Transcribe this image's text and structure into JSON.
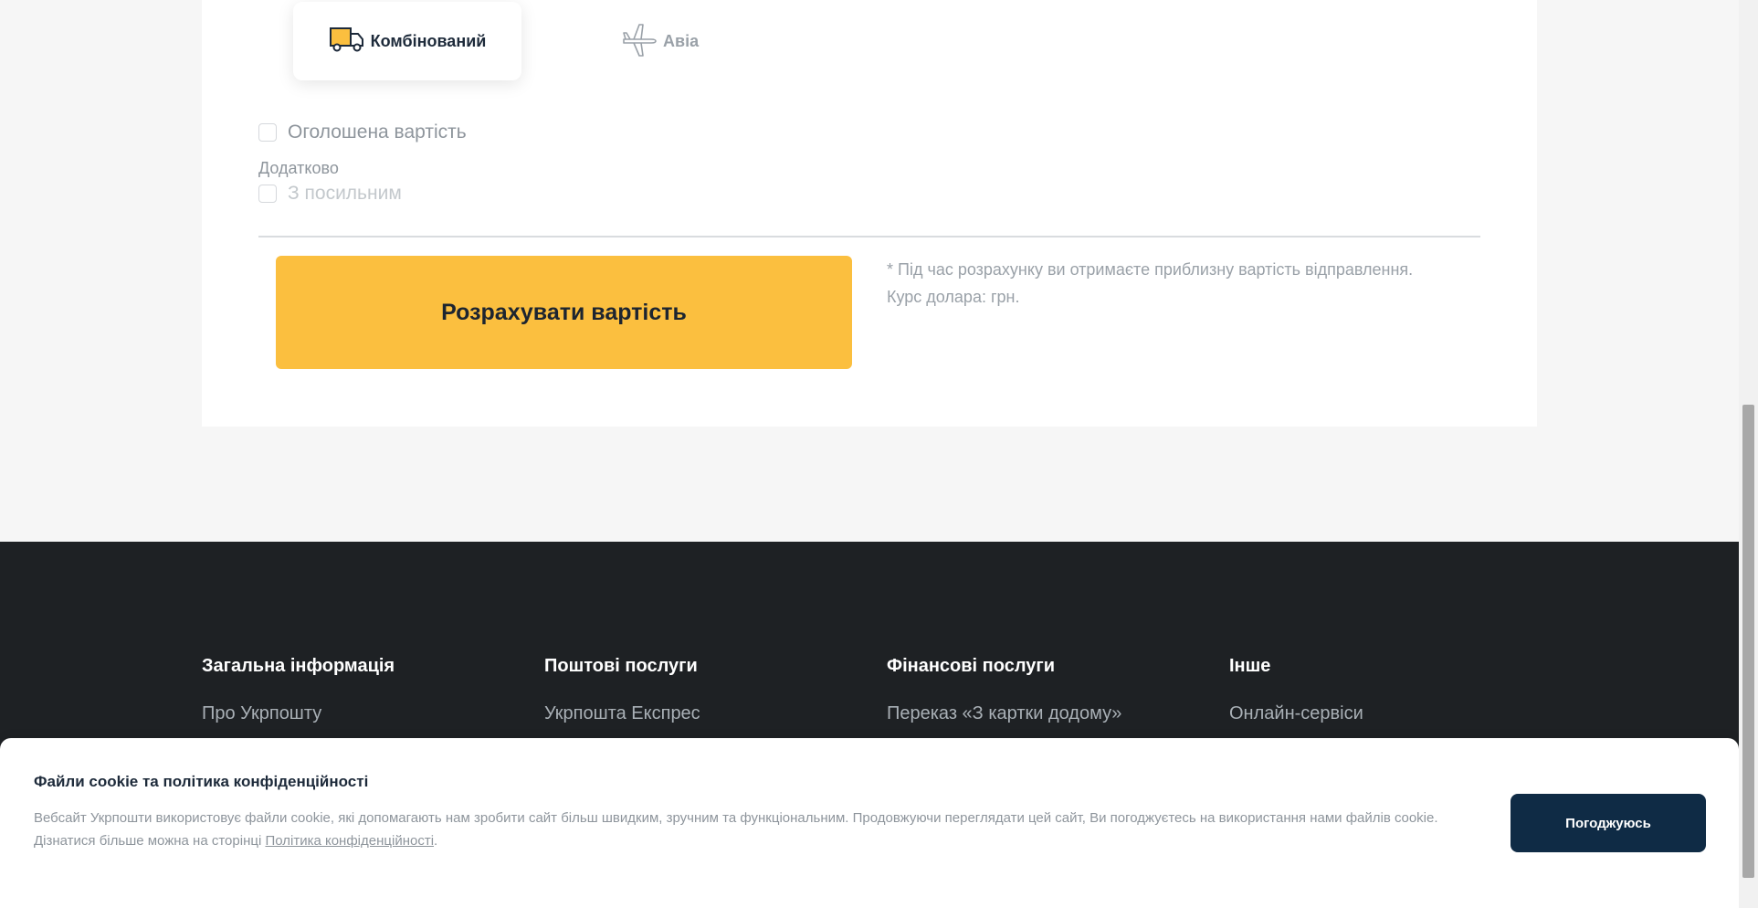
{
  "delivery_types": {
    "combined_label": "Комбінований",
    "avia_label": "Авіа"
  },
  "options": {
    "declared_value_label": "Оголошена вартість",
    "additional_label": "Додатково",
    "courier_label": "З посильним"
  },
  "calculate": {
    "button_label": "Розрахувати вартість",
    "note": "* Під час розрахунку ви отримаєте приблизну вартість відправлення.",
    "rate_label": "Курс долара: грн."
  },
  "footer": {
    "columns": [
      {
        "heading": "Загальна інформація",
        "link": "Про Укрпошту"
      },
      {
        "heading": "Поштові послуги",
        "link": "Укрпошта Експрес"
      },
      {
        "heading": "Фінансові послуги",
        "link": "Переказ «З картки додому»"
      },
      {
        "heading": "Інше",
        "link": "Онлайн-сервіси"
      }
    ]
  },
  "cookie_banner": {
    "title": "Файли cookie та політика конфіденційності",
    "text": "Вебсайт Укрпошти використовує файли cookie, які допомагають нам зробити сайт більш швидким, зручним та функціональним. Продовжуючи переглядати цей сайт, Ви погоджуєтесь на використання нами файлів cookie.",
    "more_prefix": "Дізнатися більше можна на сторінці ",
    "policy_link": "Політика конфіденційності",
    "more_suffix": ".",
    "accept_label": "Погоджуюсь"
  },
  "colors": {
    "accent": "#fbbf3f",
    "footer_bg": "#1e2124",
    "accept_bg": "#0f2b45"
  },
  "icons": {
    "combined": "truck-icon",
    "avia": "airplane-icon"
  }
}
